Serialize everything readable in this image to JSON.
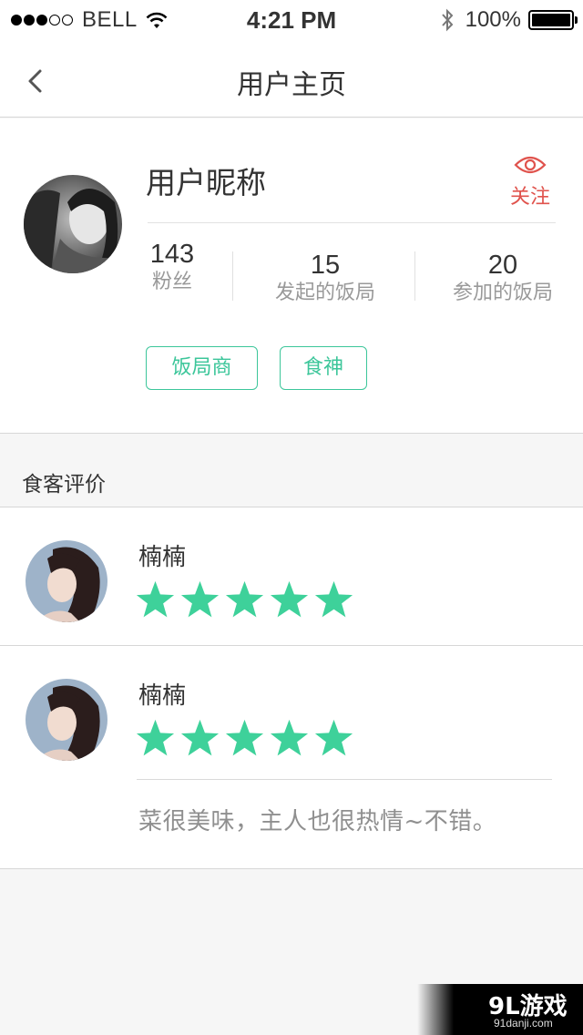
{
  "status_bar": {
    "carrier": "BELL",
    "time": "4:21 PM",
    "battery": "100%",
    "signal_bars_filled": 3,
    "signal_bars_total": 5
  },
  "nav": {
    "title": "用户主页",
    "back_icon": "chevron-left-icon"
  },
  "profile": {
    "nickname": "用户昵称",
    "follow_label": "关注",
    "follow_icon": "eye-icon",
    "stats": [
      {
        "value": "143",
        "label": "粉丝"
      },
      {
        "value": "15",
        "label": "发起的饭局"
      },
      {
        "value": "20",
        "label": "参加的饭局"
      }
    ],
    "tags": [
      "饭局商",
      "食神"
    ]
  },
  "reviews_section": {
    "title": "食客评价",
    "reviews": [
      {
        "name": "楠楠",
        "rating": 5,
        "comment": ""
      },
      {
        "name": "楠楠",
        "rating": 5,
        "comment": "菜很美味，主人也很热情~不错。"
      }
    ]
  },
  "watermark": {
    "main": "9L游戏",
    "sub": "91danji.com"
  },
  "colors": {
    "accent_green": "#3cc69a",
    "follow_red": "#e0534d",
    "star_green": "#3ed19a"
  }
}
